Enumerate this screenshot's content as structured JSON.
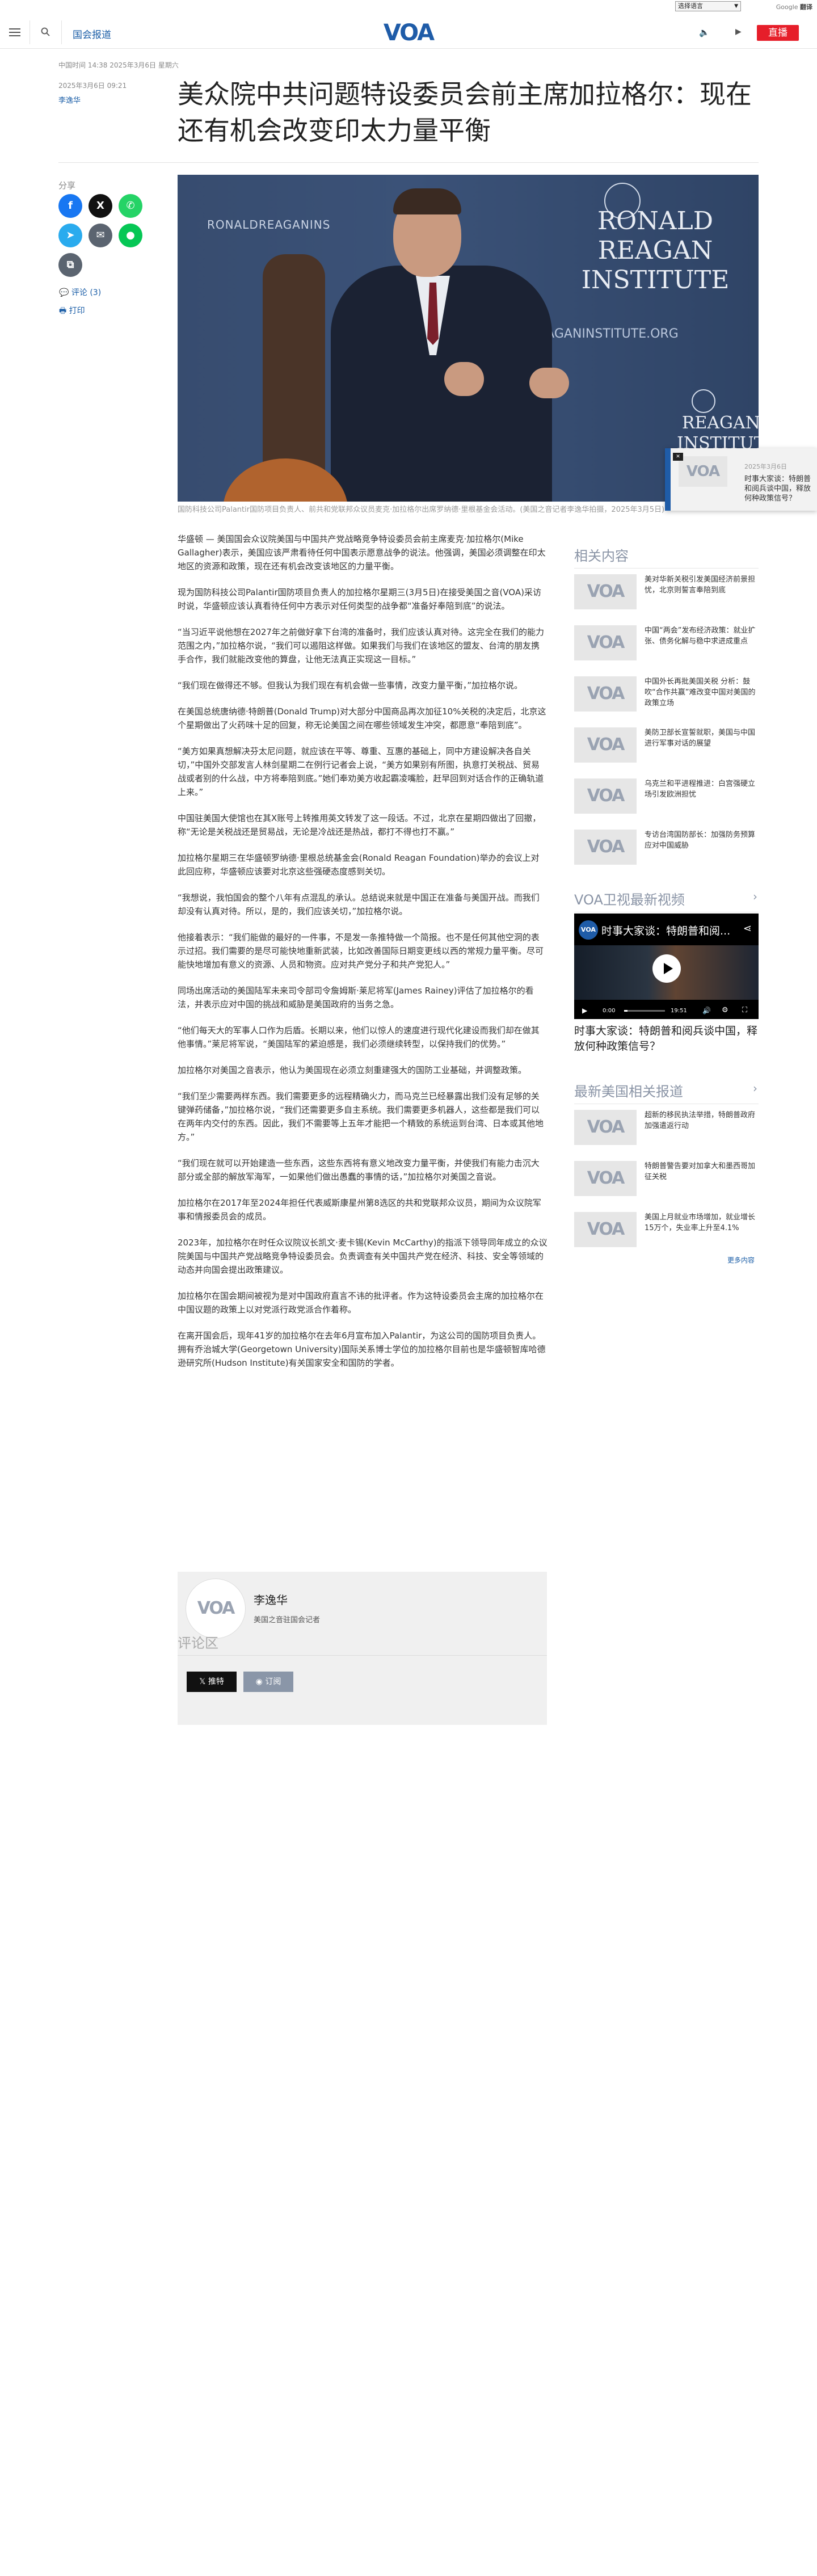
{
  "util": {
    "language_select": "选择语言",
    "google_translate": "由 Google 翻译提供支持",
    "google_word": "Google",
    "translate_word": "翻译"
  },
  "header": {
    "section": "国会报道",
    "logo": "VOA",
    "live": "直播"
  },
  "article": {
    "china_time": "中国时间 14:38 2025年3月6日 星期六",
    "published": "2025年3月6日 09:21",
    "author": "李逸华",
    "title": "美众院中共问题特设委员会前主席加拉格尔：现在还有机会改变印太力量平衡",
    "caption": "国防科技公司Palantir国防项目负责人、前共和党联邦众议员麦克·加拉格尔出席罗纳德·里根基金会活动。(美国之音记者李逸华拍摄，2025年3月5日)",
    "paragraphs": [
      "华盛顿 — 美国国会众议院美国与中国共产党战略竞争特设委员会前主席麦克·加拉格尔(Mike Gallagher)表示，美国应该严肃看待任何中国表示愿意战争的说法。他强调，美国必须调整在印太地区的资源和政策，现在还有机会改变该地区的力量平衡。",
      "现为国防科技公司Palantir国防项目负责人的加拉格尔星期三(3月5日)在接受美国之音(VOA)采访时说，华盛顿应该认真看待任何中方表示对任何类型的战争都“准备好奉陪到底”的说法。",
      "“当习近平说他想在2027年之前做好拿下台湾的准备时，我们应该认真对待。这完全在我们的能力范围之内，”加拉格尔说，“我们可以遏阻这样做。如果我们与我们在该地区的盟友、台湾的朋友携手合作，我们就能改变他的算盘，让他无法真正实现这一目标。”",
      "“我们现在做得还不够。但我认为我们现在有机会做一些事情，改变力量平衡，”加拉格尔说。",
      "在美国总统唐纳德·特朗普(Donald Trump)对大部分中国商品再次加征10%关税的决定后，北京这个星期做出了火药味十足的回复，称无论美国之间在哪些领域发生冲突，都愿意“奉陪到底”。",
      "“美方如果真想解决芬太尼问题，就应该在平等、尊重、互惠的基础上，同中方建设解决各自关切，”中国外交部发言人林剑星期二在例行记者会上说，“美方如果别有所图，执意打关税战、贸易战或者别的什么战，中方将奉陪到底。”她们奉劝美方收起霸凌嘴脸，赶早回到对话合作的正确轨道上来。”",
      "中国驻美国大使馆也在其X账号上转推用英文转发了这一段话。不过，北京在星期四做出了回撤，称“无论是关税战还是贸易战，无论是冷战还是热战，都打不得也打不赢。”",
      "加拉格尔星期三在华盛顿罗纳德·里根总统基金会(Ronald Reagan Foundation)举办的会议上对此回应称，华盛顿应该要对北京这些强硬态度感到关切。",
      "“我想说，我怕国会的整个八年有点混乱的承认。总结说来就是中国正在准备与美国开战。而我们却没有认真对待。所以，是的，我们应该关切，”加拉格尔说。",
      "他接着表示：“我们能做的最好的一件事，不是发一条推特做一个简报。也不是任何其他空洞的表示过招。我们需要的是尽可能快地重新武装，比如改善国际日期变更线以西的常规力量平衡。尽可能快地增加有意义的资源、人员和物资。应对共产党分子和共产党犯人。”",
      "同场出席活动的美国陆军未来司令部司令詹姆斯·莱尼将军(James Rainey)评估了加拉格尔的看法，并表示应对中国的挑战和威胁是美国政府的当务之急。",
      "“他们每天大的军事人口作为后盾。长期以来，他们以惊人的速度进行现代化建设而我们却在做其他事情。”莱尼将军说，“美国陆军的紧迫感是，我们必须继续转型，以保持我们的优势。”",
      "加拉格尔对美国之音表示，他认为美国现在必须立刻重建强大的国防工业基础，并调整政策。",
      "“我们至少需要两样东西。我们需要更多的远程精确火力，而马克兰已经暴露出我们没有足够的关键弹药储备，”加拉格尔说，“我们还需要更多自主系统。我们需要更多机器人，这些都是我们可以在两年内交付的东西。因此，我们不需要等上五年才能把一个精致的系统运到台湾、日本或其他地方。”",
      "“我们现在就可以开始建造一些东西，这些东西将有意义地改变力量平衡，并使我们有能力击沉大部分或全部的解放军海军，一如果他们做出愚蠢的事情的话，”加拉格尔对美国之音说。",
      "加拉格尔在2017年至2024年担任代表威斯康星州第8选区的共和党联邦众议员，期间为众议院军事和情报委员会的成员。",
      "2023年，加拉格尔在时任众议院议长凯文·麦卡锡(Kevin McCarthy)的指派下领导同年成立的众议院美国与中国共产党战略竞争特设委员会。负责调查有关中国共产党在经济、科技、安全等领域的动态并向国会提出政策建议。",
      "加拉格尔在国会期间被视为是对中国政府直言不讳的批评者。作为这特设委员会主席的加拉格尔在中国议题的政策上以对党派行政党派合作着称。",
      "在离开国会后，现年41岁的加拉格尔在去年6月宣布加入Palantir，为这公司的国防项目负责人。拥有乔治城大学(Georgetown University)国际关系博士学位的加拉格尔目前也是华盛顿智库哈德逊研究所(Hudson Institute)有关国家安全和国防的学者。"
    ]
  },
  "share": {
    "label": "分享",
    "comments": "评论 (3)",
    "print": "打印",
    "colors": {
      "facebook": "#1877f2",
      "x": "#111111",
      "whatsapp": "#25d366",
      "telegram": "#2aabee",
      "email": "#5b6470",
      "line": "#06c755",
      "copy": "#5b6470"
    }
  },
  "mini_player": {
    "date": "2025年3月6日",
    "title": "时事大家谈：特朗普和阅兵谈中国，释放何种政策信号？"
  },
  "author_card": {
    "name": "李逸华",
    "role": "美国之音驻国会记者",
    "follow_x": "推特",
    "subscribe": "订阅"
  },
  "comments_heading": "评论区",
  "sidebar": {
    "related_heading": "相关内容",
    "related": [
      "美对华新关税引发美国经济前景担忧，北京则誓言奉陪到底",
      "中国“两会”发布经济政策：就业扩张、债务化解与稳中求进成重点",
      "中国外长再批美国关税 分析：鼓吹“合作共赢”难改变中国对美国的政策立场",
      "美防卫部长宣誓就职，美国与中国进行军事对话的展望",
      "乌克兰和平进程推进：白宫强硬立场引发欧洲担忧",
      "专访台湾国防部长：加强防务预算应对中国威胁"
    ],
    "video_heading": "VOA卫视最新视频",
    "video": {
      "title": "时事大家谈：特朗普和阅...",
      "time": "0:00",
      "duration": "19:51",
      "caption": "时事大家谈：特朗普和阅兵谈中国，释放何种政策信号？"
    },
    "latest_heading": "最新美国相关报道",
    "latest": [
      "超新的移民执法举措，特朗普政府加强遣返行动",
      "特朗普警告要对加拿大和墨西哥加征关税",
      "美国上月就业市场增加，就业增长15万个，失业率上升至4.1%"
    ],
    "more": "更多内容"
  }
}
